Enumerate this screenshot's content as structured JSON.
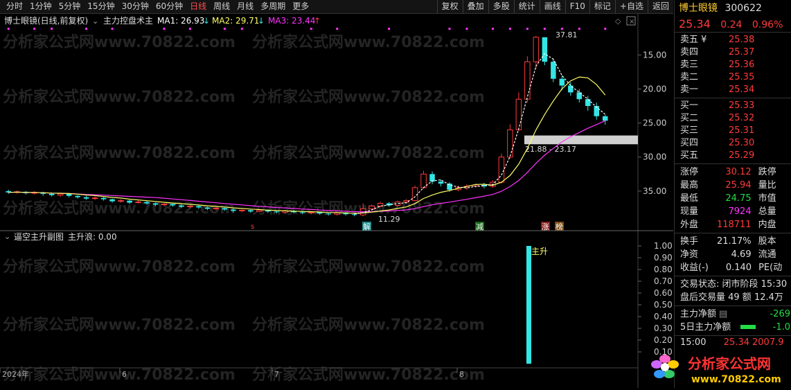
{
  "topbar": {
    "tabs": [
      "分时",
      "1分钟",
      "5分钟",
      "15分钟",
      "30分钟",
      "60分钟",
      "日线",
      "周线",
      "月线",
      "多周期",
      "更多"
    ],
    "active_tab": "日线",
    "tools": [
      "复权",
      "叠加",
      "多股",
      "统计",
      "画线",
      "F10",
      "标记",
      "+自选",
      "返回"
    ]
  },
  "main_chart": {
    "stock_label": "博士眼镜(日线,前复权)",
    "indicator_name": "主力控盘术主",
    "ma1": "MA1: 26.93",
    "ma1_arrow": "↓",
    "ma2": "MA2: 29.71",
    "ma2_arrow": "↓",
    "ma3": "MA3: 23.44",
    "ma3_arrow": "↑",
    "y_ticks": [
      "35.00",
      "30.00",
      "25.00",
      "20.00",
      "15.00"
    ],
    "peak_label": "37.81",
    "low_label": "11.29",
    "zone_label": "21.88 - 23.17",
    "signal_labels": {
      "s": "s",
      "jie": "解",
      "jian": "减",
      "zhang": "涨",
      "bang": "榜"
    },
    "colors": {
      "up": "#ff3b3b",
      "down": "#33e6e6",
      "ma1": "#ffffff",
      "ma2": "#ffff66",
      "ma3": "#ff33ff",
      "zone": "#cfcfcf"
    }
  },
  "chart_data": {
    "type": "candlestick",
    "ylim": [
      10,
      39
    ],
    "y_ticks": [
      15,
      20,
      25,
      30,
      35
    ],
    "x_labels": [
      "2024年",
      "6",
      "7",
      "8"
    ],
    "series_ma": [
      "MA1",
      "MA2",
      "MA3"
    ],
    "candles": [
      [
        15.0,
        14.8,
        15.2,
        14.6
      ],
      [
        14.8,
        14.9,
        15.1,
        14.6
      ],
      [
        14.9,
        14.7,
        15.0,
        14.5
      ],
      [
        14.7,
        14.8,
        15.0,
        14.5
      ],
      [
        14.8,
        14.6,
        14.9,
        14.3
      ],
      [
        14.6,
        14.4,
        14.8,
        14.2
      ],
      [
        14.4,
        14.6,
        14.7,
        14.2
      ],
      [
        14.6,
        14.3,
        14.7,
        14.1
      ],
      [
        14.3,
        14.1,
        14.4,
        13.9
      ],
      [
        14.1,
        13.9,
        14.3,
        13.7
      ],
      [
        13.9,
        14.0,
        14.2,
        13.7
      ],
      [
        14.0,
        13.8,
        14.1,
        13.6
      ],
      [
        13.8,
        13.5,
        13.9,
        13.3
      ],
      [
        13.5,
        13.6,
        13.8,
        13.3
      ],
      [
        13.6,
        13.3,
        13.7,
        13.1
      ],
      [
        13.3,
        13.4,
        13.6,
        13.2
      ],
      [
        13.4,
        13.2,
        13.6,
        13.0
      ],
      [
        13.2,
        13.0,
        13.3,
        12.8
      ],
      [
        13.0,
        13.1,
        13.2,
        12.8
      ],
      [
        13.1,
        12.9,
        13.2,
        12.7
      ],
      [
        12.9,
        12.7,
        13.0,
        12.5
      ],
      [
        12.7,
        12.8,
        12.9,
        12.5
      ],
      [
        12.8,
        12.6,
        12.9,
        12.4
      ],
      [
        12.6,
        12.4,
        12.7,
        12.2
      ],
      [
        12.4,
        12.5,
        12.6,
        12.2
      ],
      [
        12.5,
        12.3,
        12.6,
        12.1
      ],
      [
        12.3,
        12.1,
        12.4,
        11.9
      ],
      [
        12.1,
        12.2,
        12.3,
        11.9
      ],
      [
        12.2,
        12.0,
        12.3,
        11.8
      ],
      [
        12.0,
        12.2,
        12.3,
        11.9
      ],
      [
        12.2,
        12.0,
        12.3,
        11.8
      ],
      [
        12.0,
        11.9,
        12.2,
        11.7
      ],
      [
        11.9,
        12.1,
        12.2,
        11.7
      ],
      [
        12.1,
        11.9,
        12.2,
        11.7
      ],
      [
        11.9,
        11.8,
        12.1,
        11.6
      ],
      [
        11.8,
        11.9,
        12.0,
        11.6
      ],
      [
        11.9,
        11.7,
        12.0,
        11.5
      ],
      [
        11.7,
        11.6,
        11.8,
        11.4
      ],
      [
        11.6,
        11.8,
        11.9,
        11.4
      ],
      [
        11.8,
        11.6,
        11.9,
        11.4
      ],
      [
        11.6,
        11.5,
        11.8,
        11.3
      ],
      [
        11.5,
        12.4,
        13.2,
        11.3
      ],
      [
        12.4,
        12.8,
        13.0,
        12.2
      ],
      [
        12.8,
        13.2,
        13.4,
        12.6
      ],
      [
        13.2,
        12.9,
        13.4,
        12.7
      ],
      [
        12.9,
        13.4,
        13.6,
        12.7
      ],
      [
        13.4,
        13.6,
        13.8,
        13.2
      ],
      [
        13.6,
        15.5,
        15.8,
        13.5
      ],
      [
        15.5,
        17.5,
        18.0,
        15.3
      ],
      [
        17.5,
        16.4,
        17.9,
        16.0
      ],
      [
        16.4,
        16.1,
        16.7,
        15.7
      ],
      [
        16.1,
        15.2,
        16.3,
        14.9
      ],
      [
        15.2,
        15.5,
        15.8,
        15.0
      ],
      [
        15.5,
        15.7,
        16.0,
        15.2
      ],
      [
        15.7,
        15.9,
        16.1,
        15.5
      ],
      [
        15.9,
        15.7,
        16.2,
        15.4
      ],
      [
        15.7,
        16.3,
        16.6,
        15.5
      ],
      [
        16.3,
        20.0,
        20.5,
        16.1
      ],
      [
        20.0,
        24.0,
        24.8,
        19.8
      ],
      [
        24.0,
        28.5,
        29.5,
        23.8
      ],
      [
        28.5,
        34.0,
        34.8,
        28.0
      ],
      [
        34.0,
        37.6,
        37.8,
        33.0
      ],
      [
        37.6,
        34.0,
        37.2,
        33.5
      ],
      [
        34.0,
        31.5,
        34.5,
        31.0
      ],
      [
        31.5,
        30.5,
        32.0,
        29.8
      ],
      [
        30.5,
        29.5,
        31.0,
        29.0
      ],
      [
        29.5,
        28.5,
        30.0,
        28.0
      ],
      [
        28.5,
        27.5,
        29.0,
        26.8
      ],
      [
        27.5,
        26.0,
        28.0,
        25.5
      ],
      [
        26.0,
        25.34,
        26.2,
        24.75
      ]
    ],
    "sub": {
      "name": "逼空主升副图",
      "value_label": "主升浪: 0.00",
      "y_ticks": [
        "1.00",
        "0.90",
        "0.80",
        "0.70",
        "0.60",
        "0.50",
        "0.40",
        "0.30",
        "0.20",
        "0.10"
      ],
      "signal_label": "主升",
      "signal_value": 1.0
    }
  },
  "sub_chart": {
    "name": "逼空主升副图",
    "value_label": "主升浪: 0.00"
  },
  "right_panel": {
    "stock_name": "博士眼镜",
    "stock_code": "300622",
    "price": "25.34",
    "change": "0.24",
    "change_pct": "0.96%",
    "asks": [
      {
        "label": "卖五 ¥",
        "price": "25.38"
      },
      {
        "label": "卖四",
        "price": "25.37"
      },
      {
        "label": "卖三",
        "price": "25.36"
      },
      {
        "label": "卖二",
        "price": "25.35"
      },
      {
        "label": "卖一",
        "price": "25.34"
      }
    ],
    "bids": [
      {
        "label": "买一",
        "price": "25.33"
      },
      {
        "label": "买二",
        "price": "25.32"
      },
      {
        "label": "买三",
        "price": "25.31"
      },
      {
        "label": "买四",
        "price": "25.30"
      },
      {
        "label": "买五",
        "price": "25.29"
      }
    ],
    "stats": [
      {
        "k": "涨停",
        "v": "30.12",
        "k2": "跌停"
      },
      {
        "k": "最高",
        "v": "25.94",
        "k2": "量比"
      },
      {
        "k": "最低",
        "v": "24.75",
        "k2": "市值"
      },
      {
        "k": "现量",
        "v": "7924",
        "k2": "总量"
      },
      {
        "k": "外盘",
        "v": "118711",
        "k2": "内盘"
      }
    ],
    "stats2": [
      {
        "k": "换手",
        "v": "21.17%",
        "k2": "股本"
      },
      {
        "k": "净资",
        "v": "4.69",
        "k2": "流通"
      },
      {
        "k": "收益(-)",
        "v": "0.140",
        "k2": "PE(动"
      }
    ],
    "trade_status": "交易状态: 闭市阶段 15:30",
    "after_hours": "盘后交易量 49 额 12.4万",
    "main_net_label": "主力净额",
    "main_net_value": "-269",
    "main_net5_label": "5日主力净额",
    "main_net5_value": "-1.0",
    "tick_time": "15:00",
    "tick_price": "25.34",
    "tick_vol": "2007.9"
  },
  "watermark": "分析家公式网www.70822.com",
  "logo": {
    "title": "分析家公式网",
    "url": "www.70822.com"
  }
}
